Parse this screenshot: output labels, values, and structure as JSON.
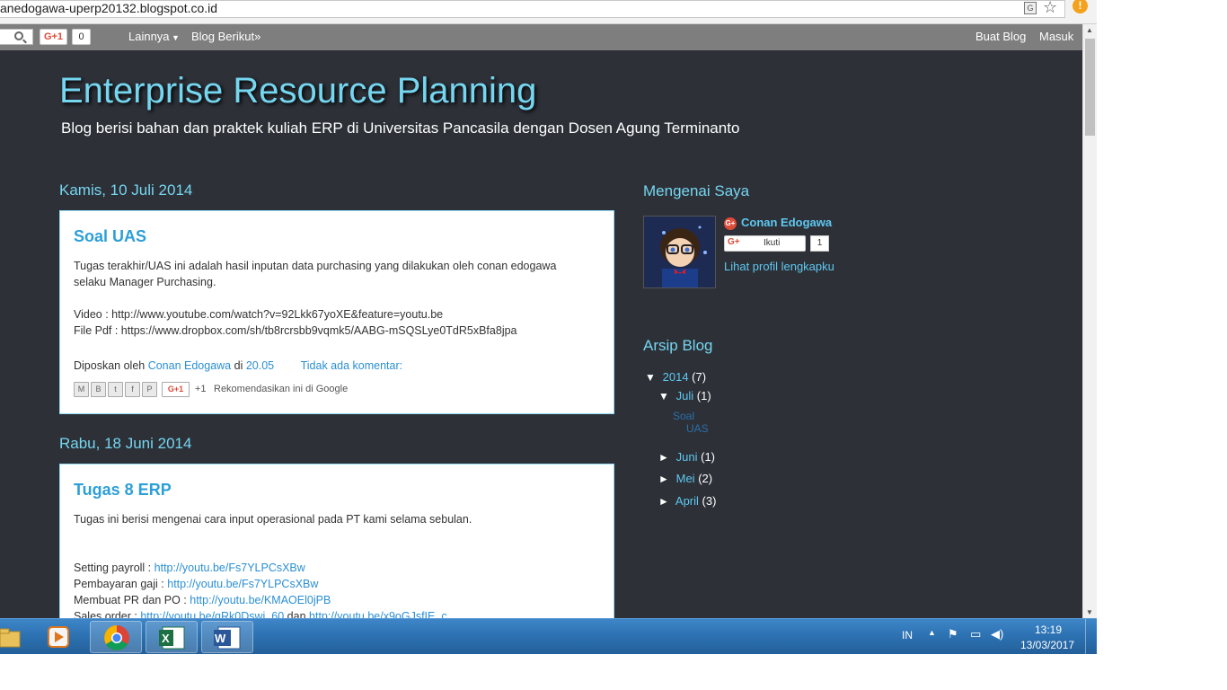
{
  "browser": {
    "url": "anedogawa-uperp20132.blogspot.co.id"
  },
  "navbar": {
    "gplus_label": "G+1",
    "gplus_count": "0",
    "more": "Lainnya",
    "next_blog": "Blog Berikut»",
    "create_blog": "Buat Blog",
    "sign_in": "Masuk"
  },
  "blog": {
    "title": "Enterprise Resource Planning",
    "description": "Blog berisi bahan dan praktek kuliah ERP di Universitas Pancasila dengan Dosen Agung Terminanto"
  },
  "posts": [
    {
      "date": "Kamis, 10 Juli 2014",
      "title": "Soal UAS",
      "body1": "Tugas terakhir/UAS ini adalah hasil inputan data purchasing yang dilakukan oleh conan edogawa",
      "body2": "selaku Manager Purchasing.",
      "video": "Video : http://www.youtube.com/watch?v=92Lkk67yoXE&feature=youtu.be",
      "pdf": "File Pdf : https://www.dropbox.com/sh/tb8rcrsbb9vqmk5/AABG-mSQSLye0TdR5xBfa8jpa",
      "posted_by": "Diposkan oleh",
      "author": "Conan Edogawa",
      "at": "di",
      "time": "20.05",
      "comments": "Tidak ada komentar:",
      "gplus": "G+1",
      "plus_one": "+1",
      "recommend": "Rekomendasikan ini di Google"
    },
    {
      "date": "Rabu, 18 Juni 2014",
      "title": "Tugas 8 ERP",
      "body1": "Tugas ini berisi mengenai cara input operasional pada PT kami selama sebulan.",
      "payroll_label": "Setting payroll :",
      "payroll_link": "http://youtu.be/Fs7YLPCsXBw",
      "gaji_label": "Pembayaran gaji :",
      "gaji_link": "http://youtu.be/Fs7YLPCsXBw",
      "prpo_label": "Membuat PR dan PO :",
      "prpo_link": "http://youtu.be/KMAOEl0jPB",
      "sales_label": "Sales order :",
      "sales_link1": "http://youtu.be/gRk0Dswi_60",
      "sales_and": "dan",
      "sales_link2": "http://youtu.be/x9oGJsfIE_c"
    }
  ],
  "sidebar": {
    "about_title": "Mengenai Saya",
    "profile_name": "Conan Edogawa",
    "follow_g": "G+",
    "follow_label": "Ikuti",
    "follow_count": "1",
    "profile_link": "Lihat profil lengkapku",
    "archive_title": "Arsip Blog",
    "archive": {
      "year": "2014",
      "year_count": "(7)",
      "months": [
        {
          "name": "Juli",
          "count": "(1)",
          "expanded": true,
          "post1": "Soal",
          "post2": "UAS"
        },
        {
          "name": "Juni",
          "count": "(1)"
        },
        {
          "name": "Mei",
          "count": "(2)"
        },
        {
          "name": "April",
          "count": "(3)"
        }
      ]
    }
  },
  "taskbar": {
    "lang": "IN",
    "time": "13:19",
    "date": "13/03/2017"
  },
  "colors": {
    "page_bg": "#2d3037",
    "title": "#75d6f0",
    "link": "#2b8fd4",
    "taskbar": "#2d73b4"
  }
}
